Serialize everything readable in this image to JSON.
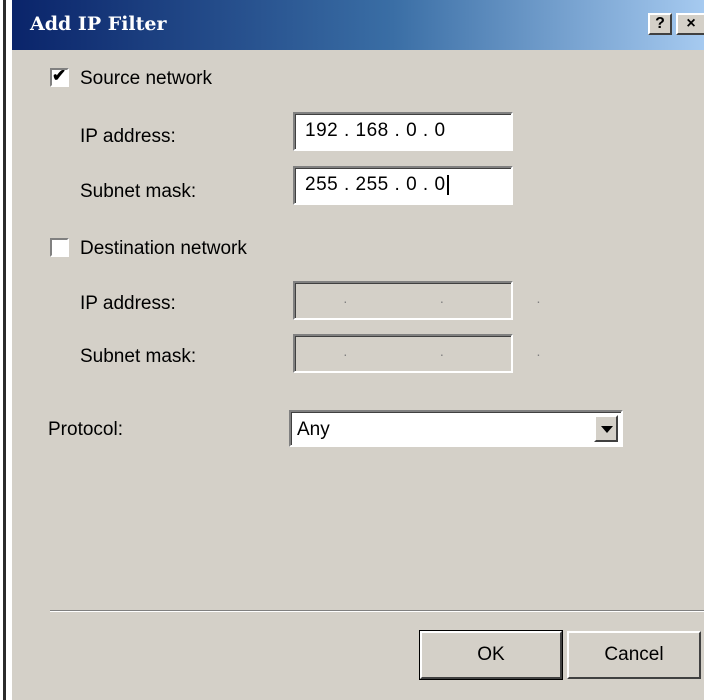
{
  "window": {
    "title": "Add IP Filter",
    "help_glyph": "?",
    "close_glyph": "×"
  },
  "source": {
    "checkbox_label": "Source network",
    "checked": true,
    "ip_label": "IP address:",
    "ip_value": "192 . 168 .  0  .  0",
    "mask_label": "Subnet mask:",
    "mask_value": "255 . 255 .  0  .  0"
  },
  "destination": {
    "checkbox_label": "Destination network",
    "checked": false,
    "ip_label": "IP address:",
    "mask_label": "Subnet mask:",
    "empty_dots": "· · ·"
  },
  "protocol": {
    "label": "Protocol:",
    "selected": "Any"
  },
  "buttons": {
    "ok": "OK",
    "cancel": "Cancel"
  }
}
